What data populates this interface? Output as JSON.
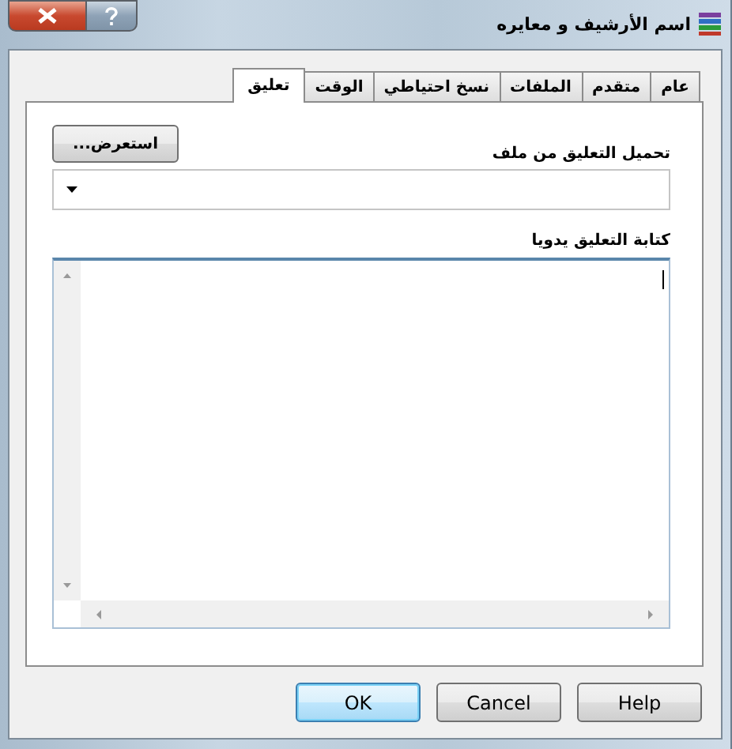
{
  "window": {
    "title": "اسم الأرشيف و معايره"
  },
  "tabs": [
    {
      "label": "عام",
      "selected": false
    },
    {
      "label": "متقدم",
      "selected": false
    },
    {
      "label": "الملفات",
      "selected": false
    },
    {
      "label": "نسخ احتياطي",
      "selected": false
    },
    {
      "label": "الوقت",
      "selected": false
    },
    {
      "label": "تعليق",
      "selected": true
    }
  ],
  "load_from_file": {
    "label": "تحميل التعليق من ملف",
    "browse_button": "استعرض..."
  },
  "manual_comment": {
    "label": "كتابة التعليق يدويا"
  },
  "buttons": [
    {
      "label": "Help",
      "default": false
    },
    {
      "label": "Cancel",
      "default": false
    },
    {
      "label": "OK",
      "default": true
    }
  ]
}
